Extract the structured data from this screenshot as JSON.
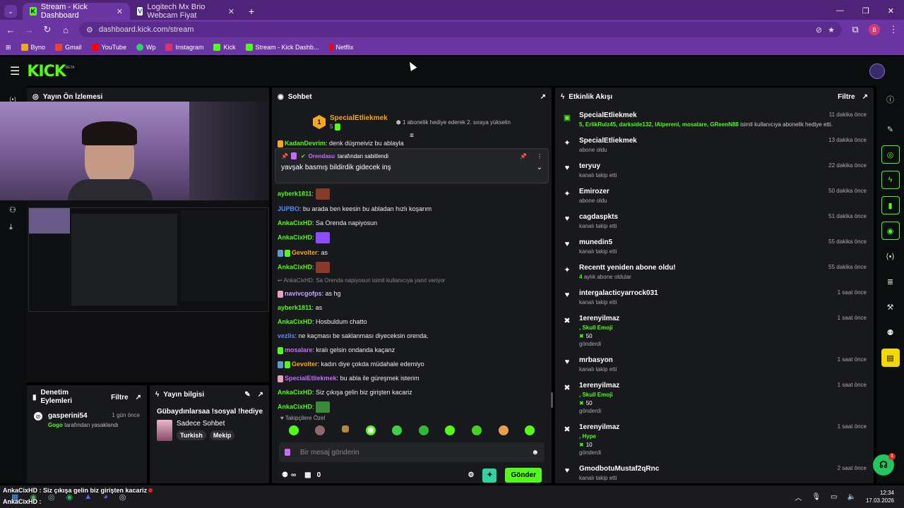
{
  "browser": {
    "tabs": [
      {
        "title": "Stream - Kick Dashboard"
      },
      {
        "title": "Logitech Mx Brio Webcam Fiyat"
      }
    ],
    "url": "dashboard.kick.com/stream",
    "avatar": "B",
    "bookmarks": [
      {
        "label": "Byno",
        "color": "#f5a623"
      },
      {
        "label": "Gmail",
        "color": "#ea4335"
      },
      {
        "label": "YouTube",
        "color": "#ff0000"
      },
      {
        "label": "Wp",
        "color": "#25d366"
      },
      {
        "label": "Instagram",
        "color": "#e1306c"
      },
      {
        "label": "Kick",
        "color": "#53fc18"
      },
      {
        "label": "Stream - Kick Dashb...",
        "color": "#53fc18"
      },
      {
        "label": "Netflix",
        "color": "#e50914"
      }
    ]
  },
  "app": {
    "logo": "KICK",
    "beta": "BETA"
  },
  "preview": {
    "title": "Yayın Ön İzlemesi"
  },
  "mod": {
    "title": "Denetim Eylemleri",
    "filter": "Filtre",
    "entry": {
      "user": "gasperini54",
      "time": "1 gün önce",
      "by": "Gogo",
      "action": "tarafından yasaklandı"
    }
  },
  "info": {
    "title": "Yayın bilgisi",
    "stream_title": "Gübaydınlarsaa !sosyal !hediye",
    "category": "Sadece Sohbet",
    "tags": [
      "Turkish",
      "Mekip"
    ]
  },
  "chat": {
    "title": "Sohbet",
    "top_user": "SpecialEtliekmek",
    "top_rank": "1",
    "top_count": "5",
    "top_msg": "1 abonelik hediye ederek 2. sıraya yükselin",
    "pinned_by": "Orendasu",
    "pinned_label": "tarafından sabitlendi",
    "pinned_msg": "yavşak basmış bildirdik gidecek inş",
    "cut_user": "KadanDevrim",
    "cut_msg": "denk düşmeiviz bu ablayla",
    "messages": [
      {
        "user": "ayberk1811",
        "color": "#53fc18",
        "text": "",
        "emote": "#8a3a2a"
      },
      {
        "user": "JUPBO",
        "color": "#4a90ff",
        "text": "bu arada ben keesin bu abladan hızlı koşarım"
      },
      {
        "user": "AnkaCixHD",
        "color": "#53fc18",
        "text": "Sa Orenda napiyosun"
      },
      {
        "user": "AnkaCixHD",
        "color": "#53fc18",
        "text": "",
        "emote": "#8c4cff"
      },
      {
        "user": "Gevolter",
        "color": "#f5a623",
        "text": "as",
        "badges": [
          "#5b9bd5",
          "#53fc18"
        ]
      },
      {
        "user": "AnkaCixHD",
        "color": "#53fc18",
        "text": "",
        "emote": "#8a3a2a"
      },
      {
        "reply": "AnkaCixHD: Sa Orenda napiyosun isimli kullanıcıya yanıt veriyor"
      },
      {
        "user": "navivcgofps",
        "color": "#c8a2ff",
        "text": "as hg",
        "badges": [
          "#e8a0c0"
        ]
      },
      {
        "user": "ayberk1811",
        "color": "#53fc18",
        "text": "as"
      },
      {
        "user": "AnkaCixHD",
        "color": "#53fc18",
        "text": "Hosbuldum chatto"
      },
      {
        "user": "vezlis",
        "color": "#4a90ff",
        "text": "ne kaçması be saklanması diyeceksin orenda."
      },
      {
        "user": "mosalare",
        "color": "#c86bff",
        "text": "kralı gelsin ondanda kaçanz",
        "badges": [
          "#53fc18"
        ]
      },
      {
        "user": "Gevolter",
        "color": "#f5a623",
        "text": "kadın diye çokda müdahale edemiyo",
        "badges": [
          "#5b9bd5",
          "#53fc18"
        ]
      },
      {
        "user": "SpecialEtliekmek",
        "color": "#c86bff",
        "text": "bu abla ile güreşmek isterim",
        "badges": [
          "#e8a0c0"
        ]
      },
      {
        "user": "AnkaCixHD",
        "color": "#53fc18",
        "text": "Siz çıkışa gelin biz girişten kacariz"
      },
      {
        "user": "AnkaCixHD",
        "color": "#53fc18",
        "text": "",
        "emote": "#3a8a3a"
      }
    ],
    "emote_label": "Takipçilere Özel",
    "placeholder": "Bir mesaj gönderin",
    "points": "∞",
    "gift_count": "0",
    "send": "Gönder"
  },
  "activity": {
    "title": "Etkinlik Akışı",
    "filter": "Filtre",
    "items": [
      {
        "icon": "gift",
        "name": "SpecialEtliekmek",
        "time": "11 dakika önce",
        "sub_green": "5, ErlikRulz45, darkside132, lAlperenl, mosalare, GReenN88",
        "sub": "isimli kullanıcıya abonelik hediye etti."
      },
      {
        "icon": "star",
        "name": "SpecialEtliekmek",
        "time": "13 dakika önce",
        "sub": "abone oldu"
      },
      {
        "icon": "heart",
        "name": "teryuy",
        "time": "22 dakika önce",
        "sub": "kanalı takip etti"
      },
      {
        "icon": "star",
        "name": "Emirozer",
        "time": "50 dakika önce",
        "sub": "abone oldu"
      },
      {
        "icon": "heart",
        "name": "cagdaspkts",
        "time": "51 dakika önce",
        "sub": "kanalı takip etti"
      },
      {
        "icon": "heart",
        "name": "munedin5",
        "time": "55 dakika önce",
        "sub": "kanalı takip etti"
      },
      {
        "icon": "star",
        "name": "Recentt yeniden abone oldu!",
        "time": "55 dakika önce",
        "sub_green": "4",
        "sub": "aylık abone oldular"
      },
      {
        "icon": "heart",
        "name": "intergalacticyarrock031",
        "time": "1 saat önce",
        "sub": "kanalı takip etti"
      },
      {
        "icon": "kick",
        "name": "1erenyilmaz",
        "time": "1 saat önce",
        "sub_green": ", Skull Emoji",
        "amount": "50",
        "sub": "gönderdi"
      },
      {
        "icon": "heart",
        "name": "mrbasyon",
        "time": "1 saat önce",
        "sub": "kanalı takip etti"
      },
      {
        "icon": "kick",
        "name": "1erenyilmaz",
        "time": "1 saat önce",
        "sub_green": ", Skull Emoji",
        "amount": "50",
        "sub": "gönderdi"
      },
      {
        "icon": "kick",
        "name": "1erenyilmaz",
        "time": "1 saat önce",
        "sub_green": ", Hype",
        "amount": "10",
        "sub": "gönderdi"
      },
      {
        "icon": "heart",
        "name": "GmodbotuMustaf2qRnc",
        "time": "2 saat önce",
        "sub": "kanalı takip etti"
      }
    ]
  },
  "support_badge": "1",
  "taskbar": {
    "ticker": "AnkaCixHD : Siz çıkışa gelin biz girişten kacariz",
    "ticker2": "AnkaCixHD :",
    "time": "12:34",
    "date": "17.03.2026"
  },
  "icons": {
    "star": "✦",
    "heart": "♥",
    "gift": "▣",
    "kick": "✖"
  }
}
